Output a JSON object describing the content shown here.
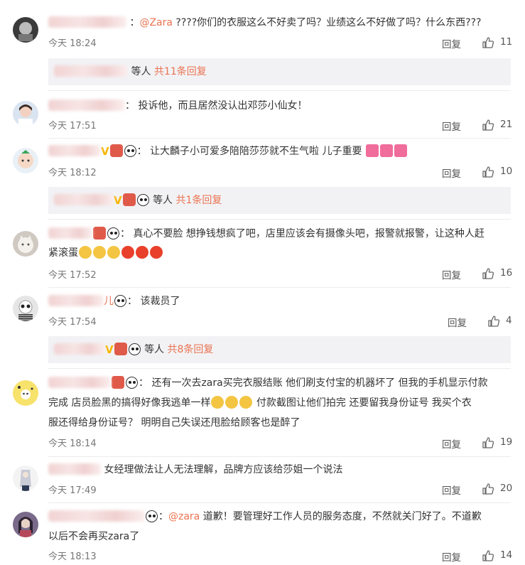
{
  "labels": {
    "reply": "回复"
  },
  "comments": [
    {
      "text": "????你们的衣服这么不好卖了吗？业绩这么不好做了吗？什么东西???",
      "mention": "@Zara",
      "time": "今天 18:24",
      "likes": "11"
    },
    {
      "text": "投诉他，而且居然没认出邓莎小仙女！",
      "time": "今天 17:51",
      "likes": "21"
    },
    {
      "text": "让大麟子小可爱多陪陪莎莎就不生气啦 儿子重要",
      "time": "今天 18:12",
      "likes": "10"
    },
    {
      "text_line1": "真心不要脸 想挣钱想疯了吧，店里应该会有摄像头吧，报警就报警，让这种人赶",
      "text_line2": "紧滚蛋",
      "time": "今天 17:52",
      "likes": "16"
    },
    {
      "name_tail": "儿",
      "text": "该裁员了",
      "time": "今天 17:54",
      "likes": "4"
    },
    {
      "text_line1": "还有一次去zara买完衣服结账 他们刷支付宝的机器坏了 但我的手机显示付款",
      "text_line2a": "完成 店员脸黑的搞得好像我逃单一样",
      "text_line2b": "付款截图让他们拍完 还要留我身份证号 我买个衣",
      "text_line3": "服还得给身份证号？ 明明自己失误还甩脸给顾客也是醉了",
      "time": "今天 18:14",
      "likes": "19"
    },
    {
      "text": "女经理做法让人无法理解，品牌方应该给莎姐一个说法",
      "time": "今天 17:49",
      "likes": "20"
    },
    {
      "mention": "@zara",
      "text_line1": "道歉！要管理好工作人员的服务态度，不然就关门好了。不道歉",
      "text_line2": "以后不会再买zara了",
      "time": "今天 18:13",
      "likes": "14"
    }
  ],
  "reply_summaries": [
    {
      "etc": "等人",
      "count": "共11条回复"
    },
    {
      "etc": "等人",
      "count": "共1条回复"
    },
    {
      "etc": "等人",
      "count": "共8条回复"
    }
  ]
}
